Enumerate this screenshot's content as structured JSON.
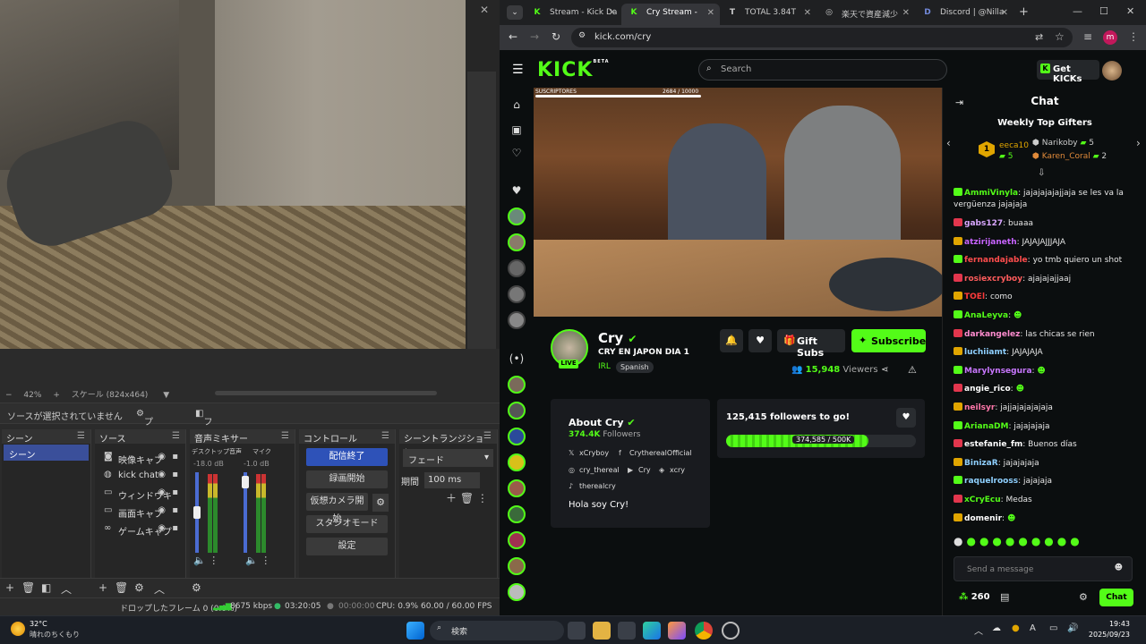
{
  "obs": {
    "preview_scale": "42%",
    "scale_label": "スケール (824x464)",
    "no_source": "ソースが選択されていません",
    "properties_label": "プロパティ",
    "filters_label": "フィルタ",
    "docks": {
      "scenes": {
        "title": "シーン",
        "items": [
          "シーン"
        ]
      },
      "sources": {
        "title": "ソース",
        "items": [
          "映像キャプ",
          "kick chat",
          "ウィンドウキ",
          "画面キャプ",
          "ゲームキャプ"
        ]
      },
      "mixer": {
        "title": "音声ミキサー",
        "ch1": "デスクトップ音声",
        "ch1_db": "-18.0 dB",
        "ch2": "マイク",
        "ch2_db": "-1.0 dB",
        "scale": [
          "0",
          "-5",
          "-10",
          "-15",
          "-20",
          "-25",
          "-30",
          "-35",
          "-40",
          "-45",
          "-50",
          "-55",
          "-60"
        ]
      },
      "controls": {
        "title": "コントロール",
        "stop_stream": "配信終了",
        "start_record": "録画開始",
        "virtual_cam": "仮想カメラ開始",
        "studio_mode": "スタジオモード",
        "settings": "設定"
      },
      "transitions": {
        "title": "シーントランジション",
        "type": "フェード",
        "duration_label": "期間",
        "duration": "100 ms"
      }
    },
    "status": {
      "dropped": "ドロップしたフレーム 0 (0.0%)",
      "kbps": "8675 kbps",
      "stream_time": "03:20:05",
      "rec_time": "00:00:00",
      "cpu": "CPU: 0.9%",
      "fps": "60.00 / 60.00 FPS"
    }
  },
  "browser": {
    "tabs": [
      {
        "label": "Stream - Kick Da",
        "icon": "K"
      },
      {
        "label": "Cry Stream - ",
        "icon": "K",
        "active": true
      },
      {
        "label": "TOTAL 3.84T",
        "icon": "T"
      },
      {
        "label": "楽天で資産減少",
        "icon": "◎"
      },
      {
        "label": "Discord | @Nilla",
        "icon": "D"
      }
    ],
    "url": "kick.com/cry"
  },
  "kick": {
    "logo": "KICK",
    "logo_beta": "BETA",
    "search_placeholder": "Search",
    "get_kicks": "Get KICKs",
    "video_overlay": {
      "label": "SUSCRIPTORES",
      "count": "2684 / 10000"
    },
    "channel": {
      "name": "Cry",
      "title": "CRY EN JAPON DIA 1",
      "category": "IRL",
      "language_tag": "Spanish",
      "live": "LIVE",
      "viewers": "15,948",
      "viewers_label": "Viewers",
      "gift_subs": "Gift Subs",
      "subscribe": "Subscribe"
    },
    "about": {
      "heading": "About Cry",
      "followers": "374.4K",
      "followers_label": "Followers",
      "socials": [
        {
          "icon": "x-icon",
          "label": "xCryboy"
        },
        {
          "icon": "facebook-icon",
          "label": "CrytherealOfficial"
        },
        {
          "icon": "instagram-icon",
          "label": "cry_thereal"
        },
        {
          "icon": "youtube-icon",
          "label": "Cry"
        },
        {
          "icon": "discord-icon",
          "label": "xcry"
        },
        {
          "icon": "tiktok-icon",
          "label": "therealcry"
        }
      ],
      "bio": "Hola soy Cry!"
    },
    "goal": {
      "heading": "125,415 followers to go!",
      "progress_text": "374,585 / 500K",
      "progress": 0.749
    }
  },
  "chat": {
    "title": "Chat",
    "gifters_title": "Weekly Top Gifters",
    "gifters": [
      {
        "name": "eeca10",
        "count": "5",
        "rank": "1"
      },
      {
        "name": "Narikoby",
        "count": "5"
      },
      {
        "name": "Karen_Coral",
        "count": "2"
      }
    ],
    "messages": [
      {
        "user": "AmmiVinyla",
        "text": "jajajajajajjaja se les va la vergüenza jajajaja",
        "color": "#53fc18"
      },
      {
        "user": "gabs127",
        "text": "buaaa",
        "color": "#d9a7ff"
      },
      {
        "user": "atzirijaneth",
        "text": "JAJAJAJJJAJA",
        "color": "#c864ff"
      },
      {
        "user": "fernandajable",
        "text": "yo tmb quiero un shot",
        "color": "#ff4d4d"
      },
      {
        "user": "rosiexcryboy",
        "text": "ajajajajjaaj",
        "color": "#ff5c5c"
      },
      {
        "user": "TOEl",
        "text": "como",
        "color": "#ff3b3b"
      },
      {
        "user": "AnaLeyva",
        "text": "",
        "color": "#53fc18"
      },
      {
        "user": "darkangelez",
        "text": "las chicas se rien",
        "color": "#ff8ccf"
      },
      {
        "user": "luchiiamt",
        "text": "JAJAJAJA",
        "color": "#8fd0ff"
      },
      {
        "user": "Marylynsegura",
        "text": "",
        "color": "#c977ff"
      },
      {
        "user": "angie_rico",
        "text": "",
        "color": "#ffffff"
      },
      {
        "user": "neilsyr",
        "text": "jajjajajajajaja",
        "color": "#ff77aa"
      },
      {
        "user": "ArianaDM",
        "text": "jajajajaja",
        "color": "#53fc18"
      },
      {
        "user": "estefanie_fm",
        "text": "Buenos días",
        "color": "#ffffff"
      },
      {
        "user": "BinizaR",
        "text": "jajajajaja",
        "color": "#8fd0ff"
      },
      {
        "user": "raquelrooss",
        "text": "jajajaja",
        "color": "#8fd0ff"
      },
      {
        "user": "xCryEcu",
        "text": "Medas",
        "color": "#53fc18"
      },
      {
        "user": "domenir",
        "text": "",
        "color": "#ffffff"
      }
    ],
    "input_placeholder": "Send a message",
    "kicks_count": "260",
    "chat_button": "Chat"
  },
  "taskbar": {
    "weather_temp": "32°C",
    "weather_desc": "晴れのちくもり",
    "search": "検索",
    "time": "19:43",
    "date": "2025/09/23"
  }
}
